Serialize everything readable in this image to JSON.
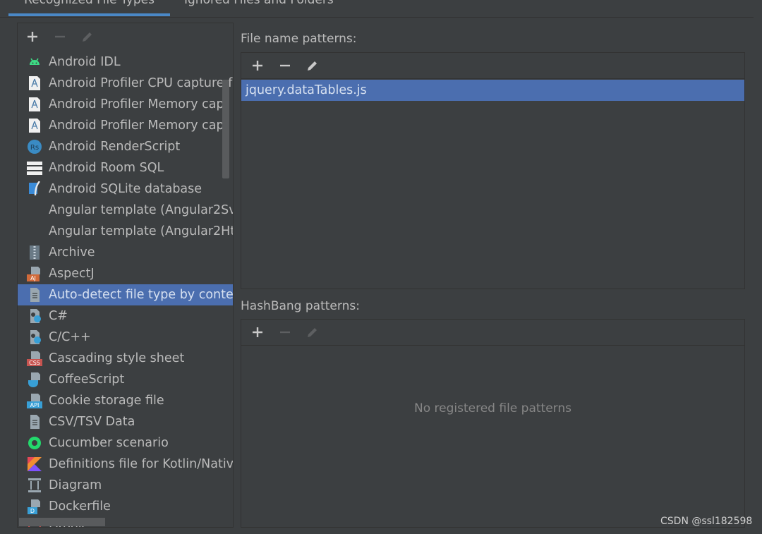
{
  "tabs": [
    {
      "label": "Recognized File Types",
      "active": true
    },
    {
      "label": "Ignored Files and Folders",
      "active": false
    }
  ],
  "file_types": [
    {
      "label": "Android IDL",
      "icon": "android-icon",
      "color": "#3ddc84"
    },
    {
      "label": "Android Profiler CPU capture f",
      "icon": "profiler-file-icon",
      "color": "#ffffff"
    },
    {
      "label": "Android Profiler Memory capt",
      "icon": "profiler-file-icon",
      "color": "#ffffff"
    },
    {
      "label": "Android Profiler Memory capt",
      "icon": "profiler-file-icon",
      "color": "#ffffff"
    },
    {
      "label": "Android RenderScript",
      "icon": "renderscript-icon",
      "color": "#3a8bc4"
    },
    {
      "label": "Android Room SQL",
      "icon": "database-table-icon",
      "color": "#ffffff"
    },
    {
      "label": "Android SQLite database",
      "icon": "sqlite-icon",
      "color": "#3a8bd8"
    },
    {
      "label": "Angular template (Angular2Sv",
      "icon": "",
      "color": ""
    },
    {
      "label": "Angular template (Angular2Ht",
      "icon": "",
      "color": ""
    },
    {
      "label": "Archive",
      "icon": "archive-icon",
      "color": "#9aa7b0"
    },
    {
      "label": "AspectJ",
      "icon": "aspectj-icon",
      "color": "#d16a3a"
    },
    {
      "label": "Auto-detect file type by conte",
      "icon": "text-file-icon",
      "color": "#9aa7b0",
      "selected": true
    },
    {
      "label": "C#",
      "icon": "csharp-file-icon",
      "color": "#9aa7b0"
    },
    {
      "label": "C/C++",
      "icon": "cpp-file-icon",
      "color": "#9aa7b0"
    },
    {
      "label": "Cascading style sheet",
      "icon": "css-file-icon",
      "color": "#c75450"
    },
    {
      "label": "CoffeeScript",
      "icon": "coffeescript-icon",
      "color": "#389fd6"
    },
    {
      "label": "Cookie storage file",
      "icon": "api-file-icon",
      "color": "#389fd6"
    },
    {
      "label": "CSV/TSV Data",
      "icon": "text-file-icon",
      "color": "#9aa7b0"
    },
    {
      "label": "Cucumber scenario",
      "icon": "cucumber-icon",
      "color": "#23d96c"
    },
    {
      "label": "Definitions file for Kotlin/Nativ",
      "icon": "kotlin-icon",
      "color": "#e44857"
    },
    {
      "label": "Diagram",
      "icon": "diagram-icon",
      "color": "#9aa7b0"
    },
    {
      "label": "Dockerfile",
      "icon": "docker-file-icon",
      "color": "#389fd6"
    },
    {
      "label": "Drools",
      "icon": "drools-icon",
      "color": "#c75450"
    }
  ],
  "file_name_patterns": {
    "label": "File name patterns:",
    "items": [
      "jquery.dataTables.js"
    ]
  },
  "hashbang_patterns": {
    "label": "HashBang patterns:",
    "empty_text": "No registered file patterns"
  },
  "watermark": "CSDN @ssl182598",
  "colors": {
    "selection": "#4b6eaf",
    "background": "#3c3f41",
    "accent": "#4a88c7"
  }
}
